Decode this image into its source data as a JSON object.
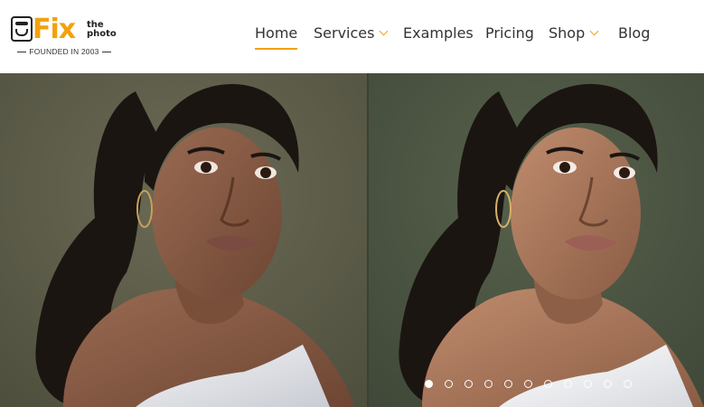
{
  "brand": {
    "logo_main": "Fix",
    "logo_the": "the",
    "logo_photo": "photo",
    "tagline": "FOUNDED IN 2003",
    "accent_color": "#f2a20c"
  },
  "nav": {
    "items": [
      {
        "label": "Home",
        "active": true
      },
      {
        "label": "Services",
        "dropdown": true
      },
      {
        "label": "Examples"
      },
      {
        "label": "Pricing"
      },
      {
        "label": "Shop",
        "dropdown": true
      },
      {
        "label": "Blog"
      }
    ]
  },
  "hero": {
    "left_image": "portrait-before",
    "right_image": "portrait-after",
    "slide_count": 11,
    "active_slide": 1
  }
}
